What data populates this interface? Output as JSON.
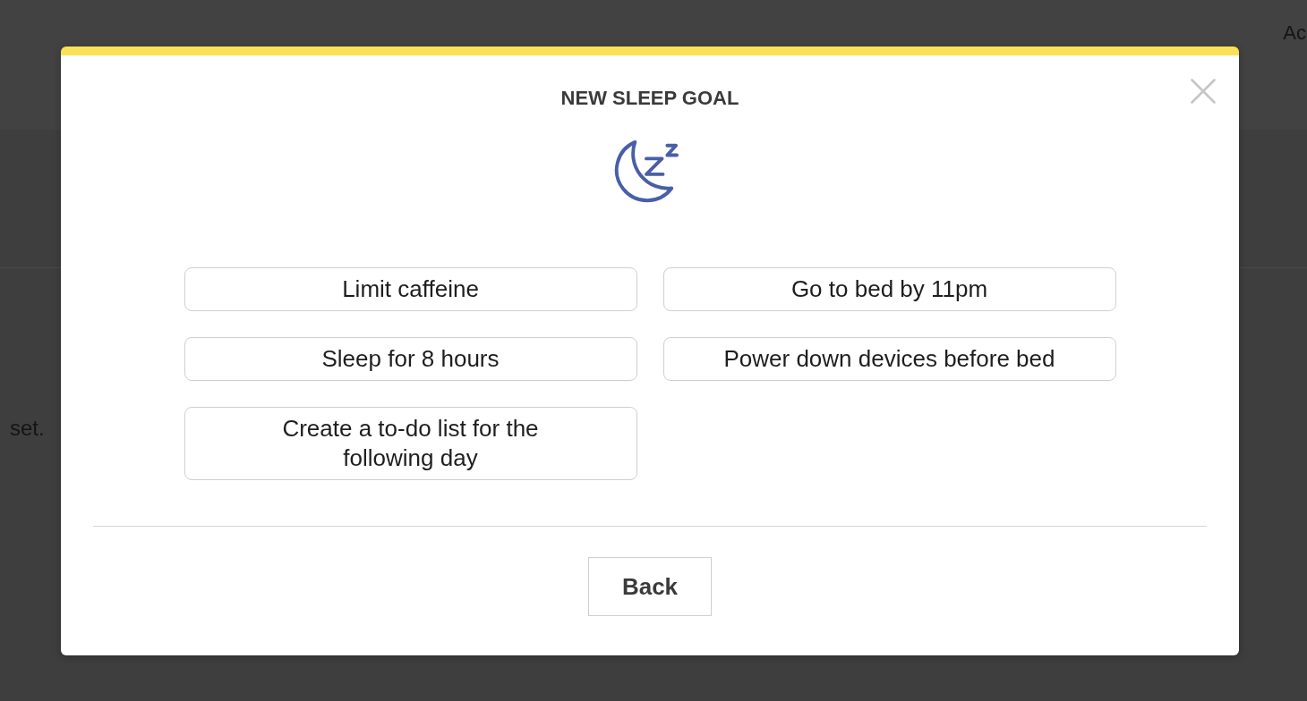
{
  "background": {
    "header_text": "Ac",
    "body_text": "set."
  },
  "dialog": {
    "title": "NEW SLEEP GOAL",
    "goals": [
      "Limit caffeine",
      "Go to bed by 11pm",
      "Sleep for 8 hours",
      "Power down devices before bed",
      "Create a to-do list for the following day"
    ],
    "back_button": "Back"
  }
}
